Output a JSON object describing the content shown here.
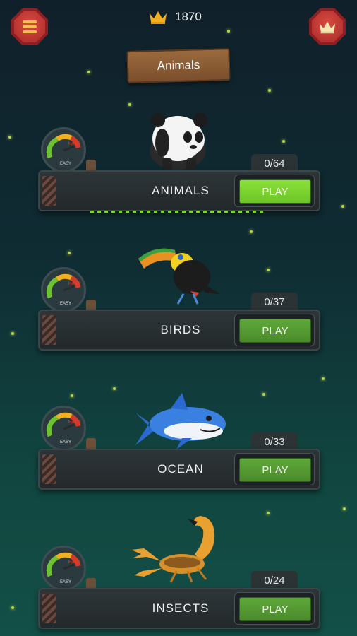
{
  "header": {
    "score": "1870",
    "category_title": "Animals"
  },
  "categories": [
    {
      "name": "ANIMALS",
      "progress": "0/64",
      "play": "PLAY",
      "gauge_low": "EASY",
      "gauge_high": "HARD"
    },
    {
      "name": "BIRDS",
      "progress": "0/37",
      "play": "PLAY",
      "gauge_low": "EASY",
      "gauge_high": "HARD"
    },
    {
      "name": "OCEAN",
      "progress": "0/33",
      "play": "PLAY",
      "gauge_low": "EASY",
      "gauge_high": "HARD"
    },
    {
      "name": "INSECTS",
      "progress": "0/24",
      "play": "PLAY",
      "gauge_low": "EASY",
      "gauge_high": "HARD"
    }
  ],
  "icons": {
    "menu": "menu-icon",
    "crown": "crown-icon",
    "gauge": "difficulty-gauge-icon"
  },
  "colors": {
    "play_active": "#7ad030",
    "play": "#4f8f2e",
    "button_red": "#b8302e",
    "crown_gold": "#f2b020"
  }
}
